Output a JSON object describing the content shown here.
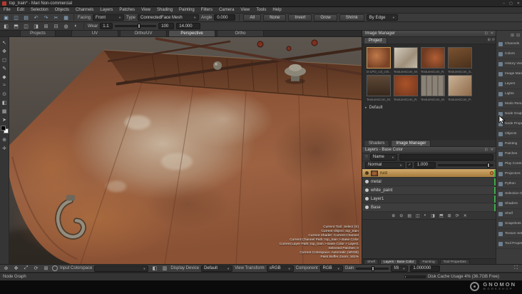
{
  "window": {
    "title": "top_train* - Mari Non-commercial",
    "controls": {
      "minimize": "–",
      "maximize": "▢",
      "close": "✕"
    }
  },
  "menu": {
    "items": [
      "File",
      "Edit",
      "Selection",
      "Objects",
      "Channels",
      "Layers",
      "Patches",
      "View",
      "Shading",
      "Painting",
      "Filters",
      "Camera",
      "View",
      "Tools",
      "Help"
    ]
  },
  "selection_toolbar": {
    "facing_label": "Facing",
    "facing_value": "Front",
    "type_label": "Type",
    "type_value": "ConnectedFace Mesh",
    "angle_label": "Angle",
    "angle_value": "0.000",
    "buttons": [
      "All",
      "None",
      "Invert",
      "Grow",
      "Shrink"
    ],
    "by_edge_label": "By Edge"
  },
  "paint_toolbar": {
    "wear_label": "Wear",
    "wear_value": "1.1",
    "radius_value": "100",
    "size_value": "14.000"
  },
  "viewport_tabs": {
    "items": [
      "Projects",
      "UV",
      "Ortho/UV",
      "Perspective",
      "Ortho"
    ]
  },
  "viewport": {
    "hud_lines": [
      "Current Tool: Select (S)",
      "Current Object: top_train",
      "Current Shader: Current Channel",
      "Current Channel Path: top_train > Base Color",
      "Current Layer Path: top_train > Base Color > Layer1",
      "Selected Patches: 0",
      "Current Colorspace: Automatic (sRGB)",
      "Paint Buffer Zoom: 161%"
    ]
  },
  "image_manager": {
    "title": "Image Manager",
    "tab": "Project",
    "row1_captions": [
      "D-LPO_col_crS...",
      "TexturesCom_M...",
      "TexturesCom_R...",
      "TexturesCom_S..."
    ],
    "row2_captions": [
      "TexturesCom_M...",
      "TexturesCom_R...",
      "TexturesCom_M...",
      "TexturesCom_P..."
    ],
    "default_item": "Default"
  },
  "dock_tabs_mid": {
    "items": [
      "Shaders",
      "Image Manager"
    ]
  },
  "layers_panel": {
    "title": "Layers - Base Color",
    "filter_field": "Name",
    "blend_mode": "Normal",
    "amount": "1.000",
    "layers": [
      {
        "name": "rust"
      },
      {
        "name": "metal"
      },
      {
        "name": "white_paint"
      },
      {
        "name": "Layer1"
      },
      {
        "name": "Base"
      }
    ]
  },
  "dock_tabs_bottom": {
    "items": [
      "Shelf",
      "Layers - Base Color",
      "Painting",
      "Tool Properties"
    ]
  },
  "right_sidebar": {
    "items": [
      "Channels",
      "Colors",
      "History View",
      "Image Manager",
      "Layers",
      "Lights",
      "Modo Render",
      "Node Graph",
      "Node Properties",
      "Objects",
      "Painting",
      "Patches",
      "Play Controls",
      "Projectors",
      "Python",
      "Selection Groups",
      "Shaders",
      "Shelf",
      "Snapshots",
      "Texture Sets",
      "Tool Properties"
    ]
  },
  "bottom_bar": {
    "input_colorspace_label": "Input Colorspace",
    "display_device_label": "Display Device",
    "display_device_value": "Default",
    "view_transform_label": "View Transform",
    "view_transform_value": "sRGB",
    "component_label": "Component",
    "component_value": "RGB",
    "gain_label": "Gain",
    "fstop_value": "f/8",
    "gain_value": "1.000000"
  },
  "status_bar": {
    "left": "Node Graph",
    "disk_cache": "Disk Cache Usage 4% (36.7GB Free)"
  },
  "logo": {
    "line1": "GNOMON",
    "line2": "WORKSHOP"
  },
  "colors": {
    "accent": "#d19a4a",
    "selection": "#c8a05c",
    "cache_green": "#3fae4a",
    "rust_base": "#9a5f3e"
  }
}
